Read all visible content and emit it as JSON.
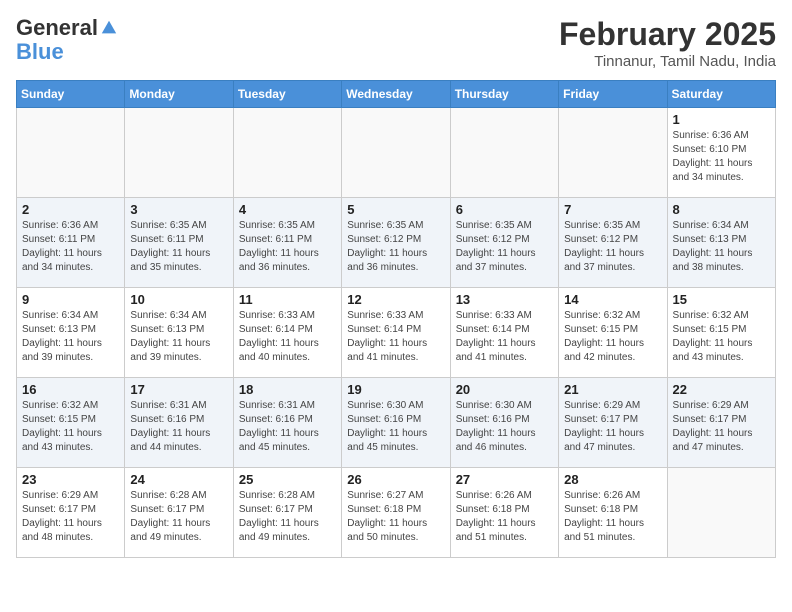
{
  "header": {
    "logo_line1": "General",
    "logo_line2": "Blue",
    "month": "February 2025",
    "location": "Tinnanur, Tamil Nadu, India"
  },
  "days_of_week": [
    "Sunday",
    "Monday",
    "Tuesday",
    "Wednesday",
    "Thursday",
    "Friday",
    "Saturday"
  ],
  "weeks": [
    [
      {
        "day": "",
        "sunrise": "",
        "sunset": "",
        "daylight": ""
      },
      {
        "day": "",
        "sunrise": "",
        "sunset": "",
        "daylight": ""
      },
      {
        "day": "",
        "sunrise": "",
        "sunset": "",
        "daylight": ""
      },
      {
        "day": "",
        "sunrise": "",
        "sunset": "",
        "daylight": ""
      },
      {
        "day": "",
        "sunrise": "",
        "sunset": "",
        "daylight": ""
      },
      {
        "day": "",
        "sunrise": "",
        "sunset": "",
        "daylight": ""
      },
      {
        "day": "1",
        "sunrise": "Sunrise: 6:36 AM",
        "sunset": "Sunset: 6:10 PM",
        "daylight": "Daylight: 11 hours and 34 minutes."
      }
    ],
    [
      {
        "day": "2",
        "sunrise": "Sunrise: 6:36 AM",
        "sunset": "Sunset: 6:11 PM",
        "daylight": "Daylight: 11 hours and 34 minutes."
      },
      {
        "day": "3",
        "sunrise": "Sunrise: 6:35 AM",
        "sunset": "Sunset: 6:11 PM",
        "daylight": "Daylight: 11 hours and 35 minutes."
      },
      {
        "day": "4",
        "sunrise": "Sunrise: 6:35 AM",
        "sunset": "Sunset: 6:11 PM",
        "daylight": "Daylight: 11 hours and 36 minutes."
      },
      {
        "day": "5",
        "sunrise": "Sunrise: 6:35 AM",
        "sunset": "Sunset: 6:12 PM",
        "daylight": "Daylight: 11 hours and 36 minutes."
      },
      {
        "day": "6",
        "sunrise": "Sunrise: 6:35 AM",
        "sunset": "Sunset: 6:12 PM",
        "daylight": "Daylight: 11 hours and 37 minutes."
      },
      {
        "day": "7",
        "sunrise": "Sunrise: 6:35 AM",
        "sunset": "Sunset: 6:12 PM",
        "daylight": "Daylight: 11 hours and 37 minutes."
      },
      {
        "day": "8",
        "sunrise": "Sunrise: 6:34 AM",
        "sunset": "Sunset: 6:13 PM",
        "daylight": "Daylight: 11 hours and 38 minutes."
      }
    ],
    [
      {
        "day": "9",
        "sunrise": "Sunrise: 6:34 AM",
        "sunset": "Sunset: 6:13 PM",
        "daylight": "Daylight: 11 hours and 39 minutes."
      },
      {
        "day": "10",
        "sunrise": "Sunrise: 6:34 AM",
        "sunset": "Sunset: 6:13 PM",
        "daylight": "Daylight: 11 hours and 39 minutes."
      },
      {
        "day": "11",
        "sunrise": "Sunrise: 6:33 AM",
        "sunset": "Sunset: 6:14 PM",
        "daylight": "Daylight: 11 hours and 40 minutes."
      },
      {
        "day": "12",
        "sunrise": "Sunrise: 6:33 AM",
        "sunset": "Sunset: 6:14 PM",
        "daylight": "Daylight: 11 hours and 41 minutes."
      },
      {
        "day": "13",
        "sunrise": "Sunrise: 6:33 AM",
        "sunset": "Sunset: 6:14 PM",
        "daylight": "Daylight: 11 hours and 41 minutes."
      },
      {
        "day": "14",
        "sunrise": "Sunrise: 6:32 AM",
        "sunset": "Sunset: 6:15 PM",
        "daylight": "Daylight: 11 hours and 42 minutes."
      },
      {
        "day": "15",
        "sunrise": "Sunrise: 6:32 AM",
        "sunset": "Sunset: 6:15 PM",
        "daylight": "Daylight: 11 hours and 43 minutes."
      }
    ],
    [
      {
        "day": "16",
        "sunrise": "Sunrise: 6:32 AM",
        "sunset": "Sunset: 6:15 PM",
        "daylight": "Daylight: 11 hours and 43 minutes."
      },
      {
        "day": "17",
        "sunrise": "Sunrise: 6:31 AM",
        "sunset": "Sunset: 6:16 PM",
        "daylight": "Daylight: 11 hours and 44 minutes."
      },
      {
        "day": "18",
        "sunrise": "Sunrise: 6:31 AM",
        "sunset": "Sunset: 6:16 PM",
        "daylight": "Daylight: 11 hours and 45 minutes."
      },
      {
        "day": "19",
        "sunrise": "Sunrise: 6:30 AM",
        "sunset": "Sunset: 6:16 PM",
        "daylight": "Daylight: 11 hours and 45 minutes."
      },
      {
        "day": "20",
        "sunrise": "Sunrise: 6:30 AM",
        "sunset": "Sunset: 6:16 PM",
        "daylight": "Daylight: 11 hours and 46 minutes."
      },
      {
        "day": "21",
        "sunrise": "Sunrise: 6:29 AM",
        "sunset": "Sunset: 6:17 PM",
        "daylight": "Daylight: 11 hours and 47 minutes."
      },
      {
        "day": "22",
        "sunrise": "Sunrise: 6:29 AM",
        "sunset": "Sunset: 6:17 PM",
        "daylight": "Daylight: 11 hours and 47 minutes."
      }
    ],
    [
      {
        "day": "23",
        "sunrise": "Sunrise: 6:29 AM",
        "sunset": "Sunset: 6:17 PM",
        "daylight": "Daylight: 11 hours and 48 minutes."
      },
      {
        "day": "24",
        "sunrise": "Sunrise: 6:28 AM",
        "sunset": "Sunset: 6:17 PM",
        "daylight": "Daylight: 11 hours and 49 minutes."
      },
      {
        "day": "25",
        "sunrise": "Sunrise: 6:28 AM",
        "sunset": "Sunset: 6:17 PM",
        "daylight": "Daylight: 11 hours and 49 minutes."
      },
      {
        "day": "26",
        "sunrise": "Sunrise: 6:27 AM",
        "sunset": "Sunset: 6:18 PM",
        "daylight": "Daylight: 11 hours and 50 minutes."
      },
      {
        "day": "27",
        "sunrise": "Sunrise: 6:26 AM",
        "sunset": "Sunset: 6:18 PM",
        "daylight": "Daylight: 11 hours and 51 minutes."
      },
      {
        "day": "28",
        "sunrise": "Sunrise: 6:26 AM",
        "sunset": "Sunset: 6:18 PM",
        "daylight": "Daylight: 11 hours and 51 minutes."
      },
      {
        "day": "",
        "sunrise": "",
        "sunset": "",
        "daylight": ""
      }
    ]
  ]
}
